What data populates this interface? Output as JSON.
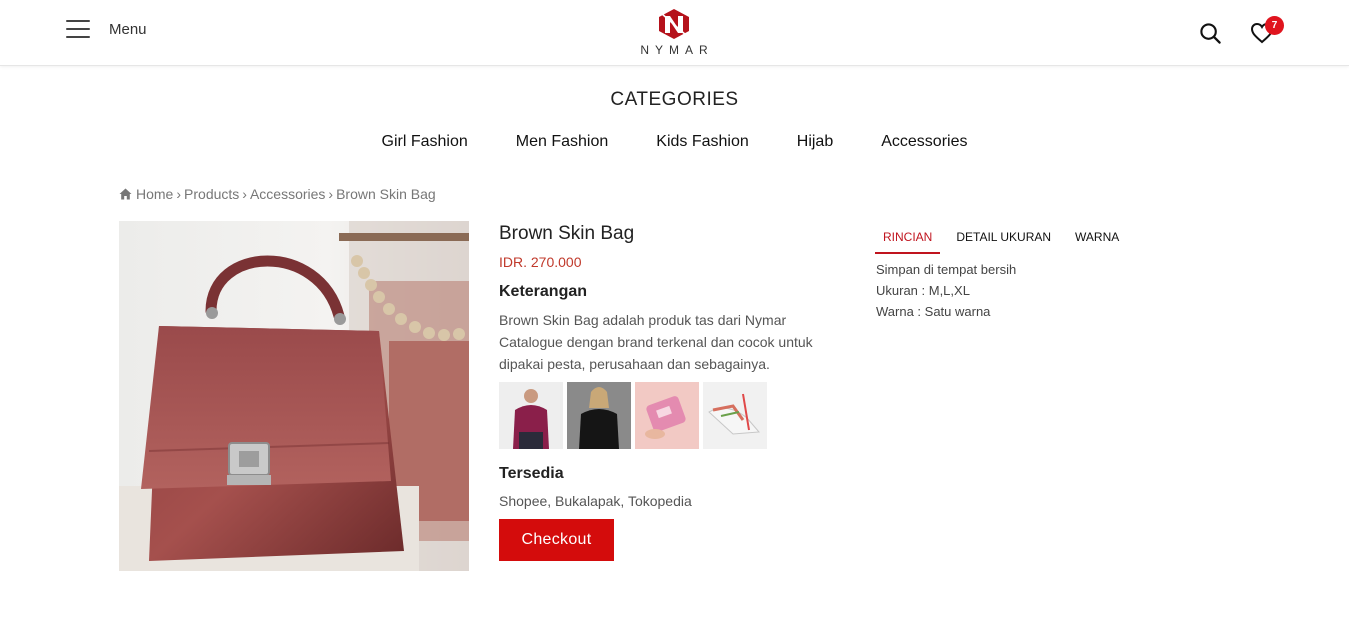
{
  "header": {
    "menu_label": "Menu",
    "logo_text": "NYMAR",
    "wishlist_count": "7"
  },
  "categories": {
    "title": "CATEGORIES",
    "items": [
      {
        "label": "Girl Fashion"
      },
      {
        "label": "Men Fashion"
      },
      {
        "label": "Kids Fashion"
      },
      {
        "label": "Hijab"
      },
      {
        "label": "Accessories"
      }
    ]
  },
  "breadcrumb": {
    "home": "Home",
    "products": "Products",
    "category": "Accessories",
    "current": "Brown Skin Bag",
    "separator": "›"
  },
  "product": {
    "title": "Brown Skin Bag",
    "price": "IDR. 270.000",
    "description_heading": "Keterangan",
    "description": "Brown Skin Bag adalah produk tas dari Nymar Catalogue dengan brand terkenal dan cocok untuk dipakai pesta, perusahaan dan sebagainya.",
    "available_heading": "Tersedia",
    "available": "Shopee, Bukalapak, Tokopedia",
    "checkout_label": "Checkout"
  },
  "tabs": {
    "items": [
      {
        "label": "RINCIAN",
        "active": true
      },
      {
        "label": "DETAIL UKURAN",
        "active": false
      },
      {
        "label": "WARNA",
        "active": false
      }
    ],
    "content": {
      "line1": "Simpan di tempat bersih",
      "line2": "Ukuran : M,L,XL",
      "line3": "Warna : Satu warna"
    }
  },
  "colors": {
    "accent": "#d40c0c",
    "price": "#c0392b",
    "tab_active": "#c0141e",
    "badge": "#e0141e"
  }
}
